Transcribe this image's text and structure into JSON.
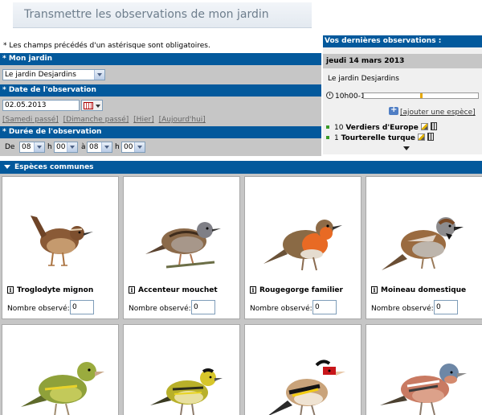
{
  "page": {
    "title": "Transmettre les observations de mon jardin",
    "required_note": "* Les champs précédés d'un astérisque sont obligatoires."
  },
  "form": {
    "garden": {
      "label": "* Mon jardin",
      "selected": "Le jardin Desjardins"
    },
    "date": {
      "label": "* Date de l'observation",
      "value": "02.05.2013",
      "quick_links": [
        "[Samedi passé]",
        "[Dimanche passé]",
        "[Hier]",
        "[Aujourd'hui]"
      ]
    },
    "duration": {
      "label": "* Durée de l'observation",
      "de": "De",
      "h1": "h",
      "a": "à",
      "h2": "h",
      "start_hour": "08",
      "start_min": "00",
      "end_hour": "08",
      "end_min": "00"
    }
  },
  "recent": {
    "title": "Vos dernières observations :",
    "date": "jeudi 14 mars 2013",
    "garden": "Le jardin Desjardins",
    "time": "10h00-10h30",
    "add_species": "[ajouter une espèce]",
    "entries": [
      {
        "count": "10",
        "species": "Verdiers d'Europe"
      },
      {
        "count": "1",
        "species": "Tourterelle turque"
      }
    ]
  },
  "species_section": {
    "title": "Espèces communes",
    "count_label": "Nombre observé:",
    "species": [
      {
        "name": "Troglodyte mignon",
        "count": "0"
      },
      {
        "name": "Accenteur mouchet",
        "count": "0"
      },
      {
        "name": "Rougegorge familier",
        "count": "0"
      },
      {
        "name": "Moineau domestique",
        "count": "0"
      },
      {
        "name": "",
        "count": ""
      },
      {
        "name": "",
        "count": ""
      },
      {
        "name": "",
        "count": ""
      },
      {
        "name": "",
        "count": ""
      }
    ]
  },
  "colors": {
    "header_blue": "#03599c",
    "panel_grey": "#c6c6c6",
    "title_text": "#6d7d8c"
  },
  "icons": {
    "calendar": "calendar-icon",
    "clock": "clock-icon",
    "edit": "edit-icon",
    "trash": "trash-icon",
    "info": "info-icon"
  }
}
